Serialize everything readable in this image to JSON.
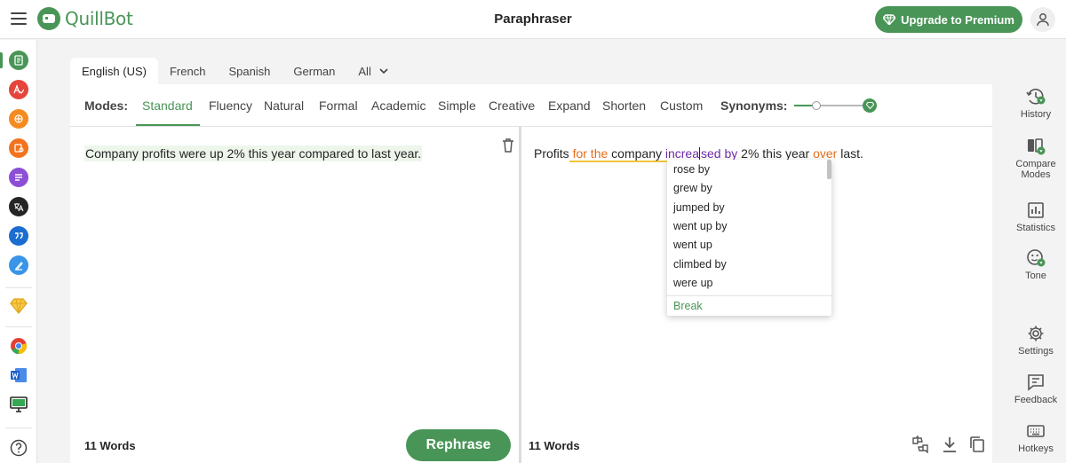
{
  "header": {
    "app_name": "QuillBot",
    "page_title": "Paraphraser",
    "upgrade_label": "Upgrade to Premium"
  },
  "language_tabs": [
    "English (US)",
    "French",
    "Spanish",
    "German",
    "All"
  ],
  "modes": {
    "label": "Modes:",
    "items": [
      "Standard",
      "Fluency",
      "Natural",
      "Formal",
      "Academic",
      "Simple",
      "Creative",
      "Expand",
      "Shorten",
      "Custom"
    ],
    "selected": "Standard",
    "synonyms_label": "Synonyms:",
    "synonyms_level": 0.3
  },
  "input": {
    "text": "Company profits were up 2% this year compared to last year.",
    "word_count": "11 Words",
    "rephrase_label": "Rephrase"
  },
  "output": {
    "segments": [
      "Profits",
      " for the",
      " company",
      " increa",
      "sed by",
      " 2% this year",
      " over",
      " last."
    ],
    "word_count": "11 Words"
  },
  "synonym_dropdown": {
    "options": [
      "rose by",
      "grew by",
      "jumped by",
      "went up by",
      "went up",
      "climbed by",
      "were up"
    ],
    "break_label": "Break"
  },
  "right_sidebar": [
    "History",
    "Compare Modes",
    "Statistics",
    "Tone",
    "Settings",
    "Feedback",
    "Hotkeys"
  ],
  "colors": {
    "brand_green": "#499557",
    "changed_word_orange": "#e46d1a",
    "structure_purple": "#6d2aa8",
    "longest_unchanged_yellow": "#f4c43a"
  }
}
